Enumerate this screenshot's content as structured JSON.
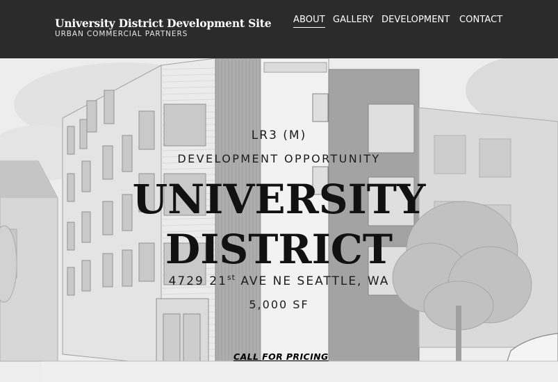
{
  "header": {
    "site_title": "University District Development Site",
    "subtitle": "URBAN COMMERCIAL PARTNERS"
  },
  "nav": {
    "items": [
      {
        "label": "ABOUT",
        "active": true
      },
      {
        "label": "GALLERY",
        "active": false
      },
      {
        "label": "DEVELOPMENT",
        "active": false
      },
      {
        "label": "CONTACT",
        "active": false
      }
    ]
  },
  "hero": {
    "zoning": "LR3 (M)",
    "headline_small": "DEVELOPMENT OPPORTUNITY",
    "headline_line1": "UNIVERSITY",
    "headline_line2": "DISTRICT",
    "address_prefix": "4729 21",
    "address_suffix_sup": "st",
    "address_rest": " AVE NE SEATTLE, WA",
    "size": "5,000 SF",
    "cta_label": "CALL FOR PRICING"
  },
  "colors": {
    "header_bg": "#2b2b2b",
    "header_text": "#ffffff",
    "hero_text": "#111111"
  }
}
